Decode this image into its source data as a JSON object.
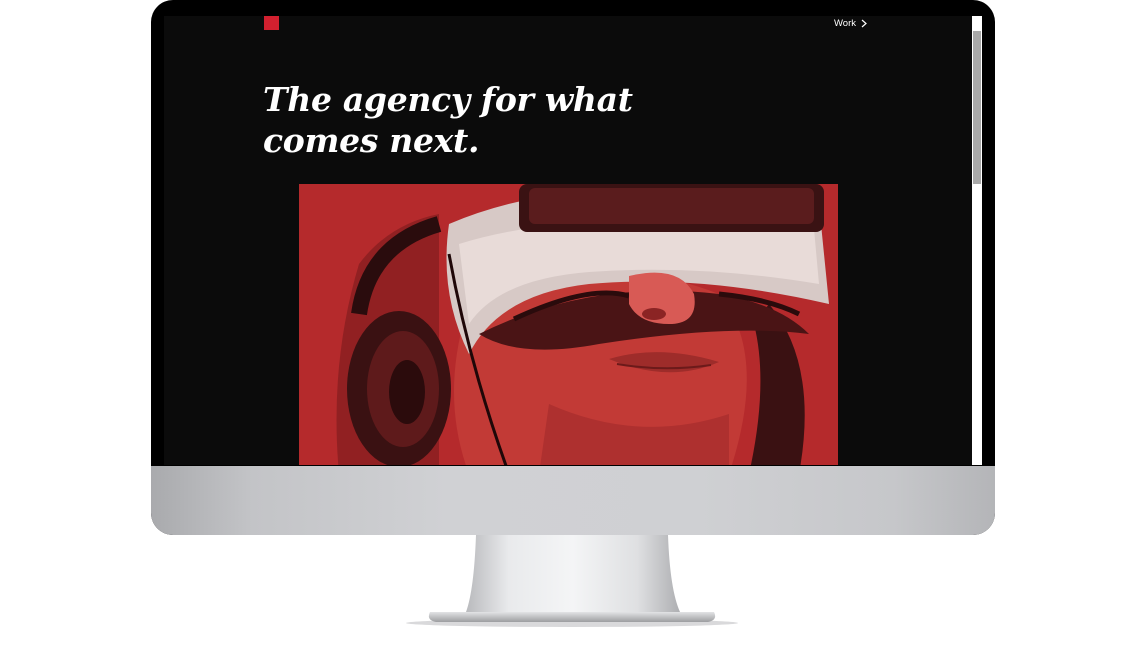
{
  "nav": {
    "work_label": "Work"
  },
  "hero": {
    "headline": "The agency for what comes next."
  },
  "colors": {
    "brand_red": "#d2202f",
    "hero_tint": "#b3262a",
    "screen_bg": "#0b0b0b"
  },
  "icons": {
    "logo": "red-square-logo",
    "nav_arrow": "chevron-right-icon"
  }
}
